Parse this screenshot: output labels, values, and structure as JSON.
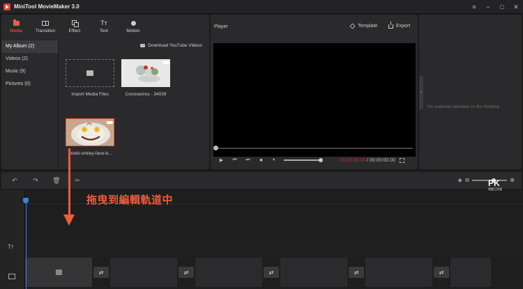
{
  "app": {
    "title": "MiniTool MovieMaker 3.0"
  },
  "window_controls": [
    "≡",
    "−",
    "□",
    "✕"
  ],
  "toolbar": [
    {
      "label": "Media",
      "icon": "folder-icon",
      "active": true
    },
    {
      "label": "Transition",
      "icon": "transition-icon",
      "active": false
    },
    {
      "label": "Effect",
      "icon": "effect-icon",
      "active": false
    },
    {
      "label": "Text",
      "icon": "text-icon",
      "active": false
    },
    {
      "label": "Motion",
      "icon": "motion-icon",
      "active": false
    }
  ],
  "albums": [
    {
      "label": "My Album (2)",
      "active": true
    },
    {
      "label": "Videos (2)",
      "active": false
    },
    {
      "label": "Music (9)",
      "active": false
    },
    {
      "label": "Pictures (0)",
      "active": false
    }
  ],
  "media": {
    "download_label": "Download YouTube Videos",
    "import_label": "Import Media Files",
    "items": [
      {
        "label": "Coronavirus - 34039"
      },
      {
        "label": "mixkit-smiley-face-b..."
      }
    ]
  },
  "player": {
    "title": "Player",
    "template_label": "Template",
    "export_label": "Export",
    "time_current": "00:00:00.00",
    "time_separator": " / ",
    "time_total": "00:00:00.00",
    "volume": 1.0,
    "progress": 0.0
  },
  "properties": {
    "empty_message": "No material selected on the timeline"
  },
  "timeline": {
    "text_track_label": "Tт",
    "zoom_level": 0.55
  },
  "annotation": {
    "text": "拖曳到編輯軌道中"
  },
  "watermark": {
    "main": "PK",
    "sub": "電腦王阿達"
  },
  "colors": {
    "accent": "#f25b3c",
    "playhead": "#3b82d9",
    "background": "#1b1b1c",
    "panel": "#2a2a2c"
  }
}
